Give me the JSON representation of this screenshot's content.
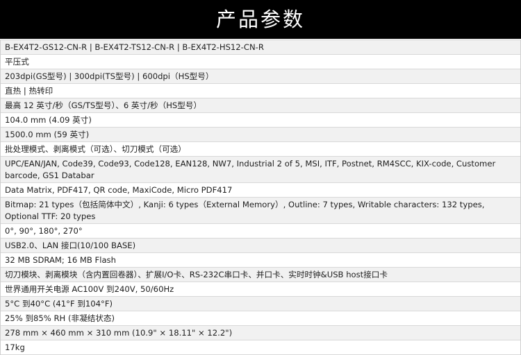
{
  "header": {
    "title": "产品参数",
    "background_color": "#000000",
    "text_color": "#ffffff"
  },
  "specs": [
    "B-EX4T2-GS12-CN-R | B-EX4T2-TS12-CN-R | B-EX4T2-HS12-CN-R",
    "平压式",
    "203dpi(GS型号) | 300dpi(TS型号) | 600dpi（HS型号）",
    "直热 | 热转印",
    "最高 12 英寸/秒（GS/TS型号）、6 英寸/秒（HS型号）",
    "104.0 mm (4.09 英寸)",
    "1500.0 mm (59 英寸)",
    "批处理模式、剥离模式（可选）、切刀模式（可选）",
    "UPC/EAN/JAN, Code39, Code93, Code128, EAN128, NW7, Industrial 2 of 5, MSI, ITF, Postnet, RM4SCC, KIX-code, Customer barcode, GS1 Databar",
    "Data Matrix, PDF417, QR code, MaxiCode, Micro PDF417",
    "Bitmap: 21 types（包括简体中文）, Kanji: 6 types（External Memory）, Outline: 7 types, Writable characters: 132 types, Optional TTF: 20 types",
    "0°, 90°, 180°, 270°",
    "USB2.0、LAN 接口(10/100 BASE)",
    "32 MB SDRAM; 16 MB Flash",
    "切刀模块、剥离模块（含内置回卷器）、扩展I/O卡、RS-232C串口卡、并口卡、实时时钟&USB host接口卡",
    "世界通用开关电源 AC100V 到240V, 50/60Hz",
    "5°C 到40°C (41°F 到104°F)",
    "25% 到85% RH (非凝结状态)",
    "278 mm × 460 mm × 310 mm (10.9\" × 18.11\" × 12.2\")",
    "17kg"
  ],
  "colors": {
    "row_alt_background": "#f1f1f1",
    "row_background": "#ffffff",
    "divider": "#d8d8d8",
    "text": "#1e1e1e"
  }
}
